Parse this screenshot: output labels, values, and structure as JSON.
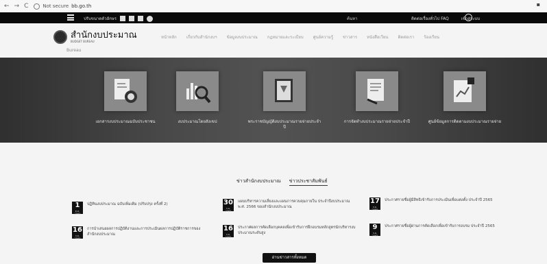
{
  "browser": {
    "url_label": "Not secure",
    "url": "bb.go.th"
  },
  "topbar": {
    "tools_label": "ปรับขนาดตัวอักษร",
    "search_label": "ค้นหา",
    "faq_label": "ติดต่อเรื่องทั่วไป FAQ",
    "login_label": "เข้าสู่ระบบ"
  },
  "header": {
    "logo_title": "สำนักงบประมาณ",
    "logo_sub": "BUDGET BUREAU",
    "menu": [
      "หน้าหลัก",
      "เกี่ยวกับสำนักงบฯ",
      "ข้อมูลงบประมาณ",
      "กฎหมายและระเบียบ",
      "ศูนย์ความรู้",
      "ข่าวสาร",
      "หนังสือเวียน",
      "ติดต่อเรา",
      "ร้องเรียน"
    ],
    "breadcrumb": "Bureau"
  },
  "cards": [
    {
      "label": "เอกสารงบประมาณฉบับประชาชน"
    },
    {
      "label": "งบประมาณโดยสังเขป"
    },
    {
      "label": "พระราชบัญญัติงบประมาณรายจ่ายประจำปี"
    },
    {
      "label": "การจัดทำงบประมาณรายจ่ายประจำปี"
    },
    {
      "label": "ศูนย์ข้อมูลการติดตามงบประมาณรายจ่าย"
    }
  ],
  "tabs": {
    "tab1": "ข่าวสำนักงบประมาณ",
    "tab2": "ข่าวประชาสัมพันธ์"
  },
  "news": [
    {
      "day": "1",
      "month": "ต.ค. 2565",
      "text": "ปฏิทินงบประมาณ ฉบับเพิ่มเติม (ปรับปรุง ครั้งที่ 2)"
    },
    {
      "day": "30",
      "month": "ก.ย. 2565",
      "text": "แผนบริหารความเสี่ยงและแผนการควบคุมภายใน ประจำปีงบประมาณ พ.ศ. 2566 ของสำนักงบประมาณ"
    },
    {
      "day": "17",
      "month": "ก.ย. 2565",
      "text": "ประกาศรายชื่อผู้มีสิทธิเข้ารับการประเมินเพื่อแต่งตั้ง ประจำปี 2565"
    },
    {
      "day": "16",
      "month": "ก.ย. 2565",
      "text": "การนำเสนอผลการปฏิบัติงานและการประเมินผลการปฏิบัติราชการของสำนักงบประมาณ"
    },
    {
      "day": "16",
      "month": "ก.ย. 2565",
      "text": "ประกาศผลการคัดเลือกบุคคลเพื่อเข้ารับการฝึกอบรมหลักสูตรนักบริหารงบประมาณระดับสูง"
    },
    {
      "day": "9",
      "month": "ก.ย. 2565",
      "text": "ประกาศรายชื่อผู้ผ่านการคัดเลือกเพื่อเข้ารับการอบรม ประจำปี 2565"
    }
  ],
  "more_label": "อ่านข่าวสารทั้งหมด"
}
